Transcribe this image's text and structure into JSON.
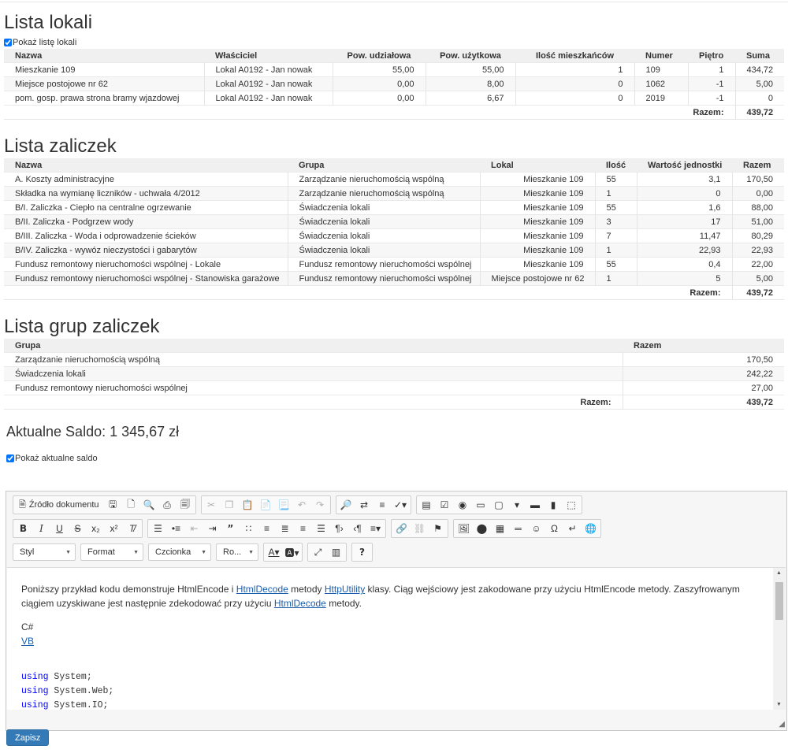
{
  "locals": {
    "title": "Lista lokali",
    "toggle_label": "Pokaż listę lokali",
    "headers": [
      "Nazwa",
      "Właściciel",
      "Pow. udziałowa",
      "Pow. użytkowa",
      "Ilość mieszkańców",
      "Numer",
      "Piętro",
      "Suma"
    ],
    "rows": [
      [
        "Mieszkanie 109",
        "Lokal A0192 - Jan nowak",
        "55,00",
        "55,00",
        "1",
        "109",
        "1",
        "434,72"
      ],
      [
        "Miejsce postojowe nr 62",
        "Lokal A0192 - Jan nowak",
        "0,00",
        "8,00",
        "0",
        "1062",
        "-1",
        "5,00"
      ],
      [
        "pom. gosp. prawa strona bramy wjazdowej",
        "Lokal A0192 - Jan nowak",
        "0,00",
        "6,67",
        "0",
        "2019",
        "-1",
        "0"
      ]
    ],
    "total_label": "Razem:",
    "total_value": "439,72"
  },
  "advances": {
    "title": "Lista zaliczek",
    "headers": [
      "Nazwa",
      "Grupa",
      "Lokal",
      "Ilość",
      "Wartość jednostki",
      "Razem"
    ],
    "rows": [
      [
        "A. Koszty administracyjne",
        "Zarządzanie nieruchomością wspólną",
        "Mieszkanie 109",
        "55",
        "3,1",
        "170,50"
      ],
      [
        "Składka na wymianę liczników - uchwała 4/2012",
        "Zarządzanie nieruchomością wspólną",
        "Mieszkanie 109",
        "1",
        "0",
        "0,00"
      ],
      [
        "B/I. Zaliczka - Ciepło na centralne ogrzewanie",
        "Świadczenia lokali",
        "Mieszkanie 109",
        "55",
        "1,6",
        "88,00"
      ],
      [
        "B/II. Zaliczka - Podgrzew wody",
        "Świadczenia lokali",
        "Mieszkanie 109",
        "3",
        "17",
        "51,00"
      ],
      [
        "B/III. Zaliczka - Woda i odprowadzenie ścieków",
        "Świadczenia lokali",
        "Mieszkanie 109",
        "7",
        "11,47",
        "80,29"
      ],
      [
        "B/IV. Zaliczka - wywóz nieczystości i gabarytów",
        "Świadczenia lokali",
        "Mieszkanie 109",
        "1",
        "22,93",
        "22,93"
      ],
      [
        "Fundusz remontowy nieruchomości wspólnej - Lokale",
        "Fundusz remontowy nieruchomości wspólnej",
        "Mieszkanie 109",
        "55",
        "0,4",
        "22,00"
      ],
      [
        "Fundusz remontowy nieruchomości wspólnej - Stanowiska garażowe",
        "Fundusz remontowy nieruchomości wspólnej",
        "Miejsce postojowe nr 62",
        "1",
        "5",
        "5,00"
      ]
    ],
    "total_label": "Razem:",
    "total_value": "439,72"
  },
  "groups": {
    "title": "Lista grup zaliczek",
    "headers": [
      "Grupa",
      "Razem"
    ],
    "rows": [
      [
        "Zarządzanie nieruchomością wspólną",
        "170,50"
      ],
      [
        "Świadczenia lokali",
        "242,22"
      ],
      [
        "Fundusz remontowy nieruchomości wspólnej",
        "27,00"
      ]
    ],
    "total_label": "Razem:",
    "total_value": "439,72"
  },
  "saldo": {
    "text": "Aktualne Saldo: 1 345,67 zł",
    "toggle_label": "Pokaż aktualne saldo"
  },
  "editor": {
    "source_label": "Źródło dokumentu",
    "combos": {
      "style": "Styl",
      "format": "Format",
      "font": "Czcionka",
      "size": "Ro..."
    },
    "content": {
      "p1_a": "Poniższy przykład kodu demonstruje HtmlEncode i ",
      "link_htmldecode": "HtmlDecode",
      "p1_b": " metody ",
      "link_httputility": "HttpUtility",
      "p1_c": " klasy. Ciąg wejściowy jest zakodowane przy użyciu HtmlEncode metody. Zaszyfrowanym ciągiem uzyskiwane jest następnie zdekodować przy użyciu ",
      "link_htmldecode2": "HtmlDecode",
      "p1_d": " metody.",
      "lang_cs": "C#",
      "lang_vb": "VB",
      "code": [
        {
          "kw": "using",
          "rest": " System;"
        },
        {
          "kw": "using",
          "rest": " System.Web;"
        },
        {
          "kw": "using",
          "rest": " System.IO;"
        }
      ]
    }
  },
  "save_label": "Zapisz"
}
